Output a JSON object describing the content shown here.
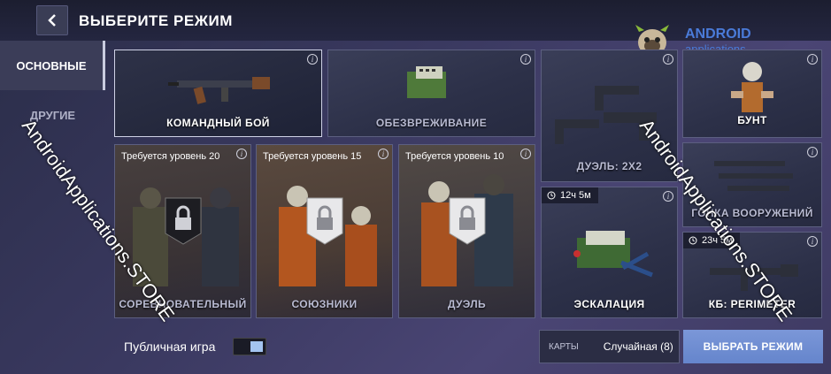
{
  "header": {
    "title": "ВЫБЕРИТЕ РЕЖИМ"
  },
  "logo": {
    "line1": "ANDROID",
    "line2": "applications"
  },
  "sidebar": {
    "items": [
      {
        "label": "ОСНОВНЫЕ",
        "active": true
      },
      {
        "label": "ДРУГИЕ",
        "active": false
      }
    ]
  },
  "modes": {
    "team_fight": {
      "label": "КОМАНДНЫЙ БОЙ"
    },
    "defuse": {
      "label": "ОБЕЗВРЕЖИВАНИЕ"
    },
    "duel2x2": {
      "label": "ДУЭЛЬ: 2X2"
    },
    "riot": {
      "label": "БУНТ"
    },
    "competitive": {
      "label": "СОРЕВНОВАТЕЛЬНЫЙ",
      "requirement": "Требуется уровень 20"
    },
    "allies": {
      "label": "СОЮЗНИКИ",
      "requirement": "Требуется уровень 15"
    },
    "duel": {
      "label": "ДУЭЛЬ",
      "requirement": "Требуется уровень 10"
    },
    "arms_race": {
      "label": "ГОНКА ВООРУЖЕНИЙ"
    },
    "escalation": {
      "label": "ЭСКАЛАЦИЯ",
      "timer": "12ч 5м"
    },
    "perimeter": {
      "label": "КБ: PERIMETER",
      "timer": "23ч 5м"
    }
  },
  "footer": {
    "public_label": "Публичная игра",
    "public_enabled": true,
    "maps_label": "КАРТЫ",
    "maps_value": "Случайная (8)",
    "select_button": "ВЫБРАТЬ РЕЖИМ"
  },
  "watermarks": {
    "left": "AndroidApplications.STORE",
    "right": "AndroidApplications.STORE"
  },
  "colors": {
    "accent": "#7b97d8",
    "brand": "#4a7bd9",
    "background": "#3a3960"
  }
}
